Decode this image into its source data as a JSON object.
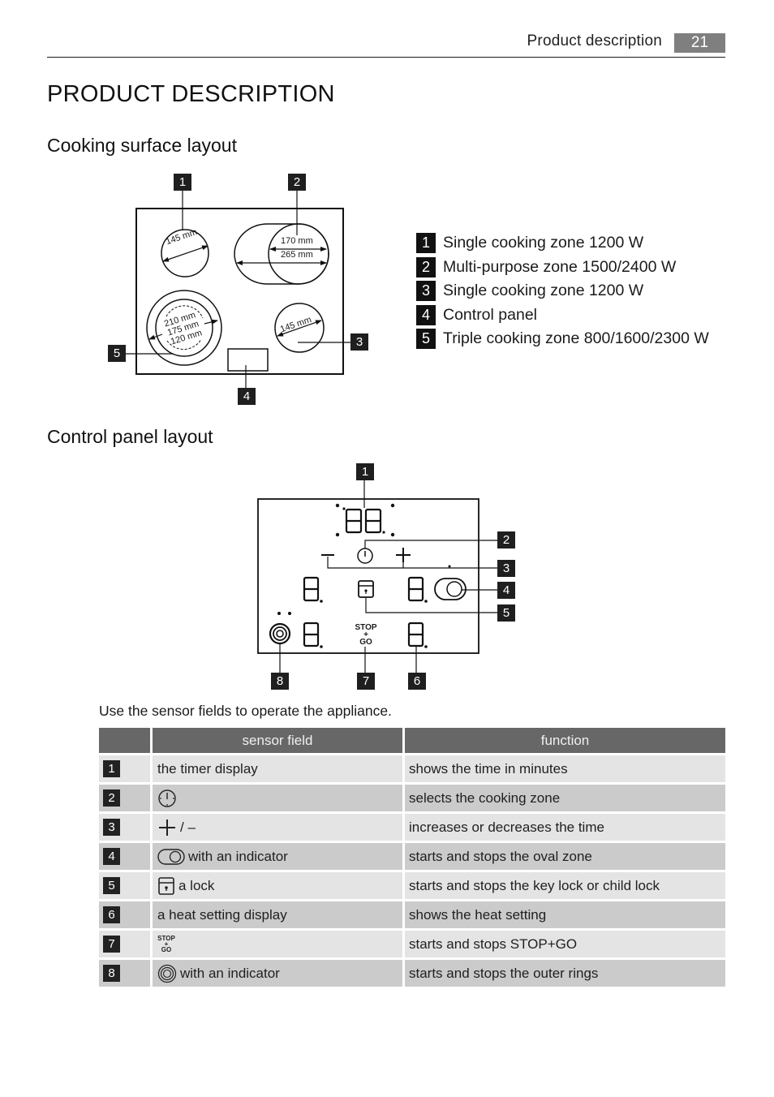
{
  "header": {
    "running_title": "Product description",
    "page_number": "21"
  },
  "page_title": "PRODUCT DESCRIPTION",
  "cooking_surface": {
    "heading": "Cooking surface layout",
    "callouts": [
      "1",
      "2",
      "3",
      "4",
      "5"
    ],
    "dimensions": {
      "zone1": "145 mm",
      "zone2_inner": "170 mm",
      "zone2_outer": "265 mm",
      "zone3": "145 mm",
      "zone5_outer": "210 mm",
      "zone5_middle": "175 mm",
      "zone5_inner": "120 mm"
    },
    "legend": [
      {
        "num": "1",
        "text": "Single cooking zone 1200 W"
      },
      {
        "num": "2",
        "text": "Multi-purpose zone 1500/2400 W"
      },
      {
        "num": "3",
        "text": "Single cooking zone 1200 W"
      },
      {
        "num": "4",
        "text": "Control panel"
      },
      {
        "num": "5",
        "text": "Triple cooking zone 800/1600/2300 W"
      }
    ]
  },
  "control_panel": {
    "heading": "Control panel layout",
    "callouts": [
      "1",
      "2",
      "3",
      "4",
      "5",
      "6",
      "7",
      "8"
    ],
    "stop_label": "STOP",
    "plus_label": "+",
    "go_label": "GO"
  },
  "intro_text": "Use the sensor fields to operate the appliance.",
  "table": {
    "headers": [
      "",
      "sensor field",
      "function"
    ],
    "rows": [
      {
        "num": "1",
        "icon": "none",
        "sensor": "the timer display",
        "function": "shows the time in minutes"
      },
      {
        "num": "2",
        "icon": "timer-select-icon",
        "sensor": "",
        "function": "selects the cooking zone"
      },
      {
        "num": "3",
        "icon": "plus-icon",
        "sensor": "/ –",
        "function": "increases or decreases the time"
      },
      {
        "num": "4",
        "icon": "oval-zone-icon",
        "sensor": "with an indicator",
        "function": "starts and stops the oval zone"
      },
      {
        "num": "5",
        "icon": "lock-icon",
        "sensor": "a lock",
        "function": "starts and stops the key lock or child lock"
      },
      {
        "num": "6",
        "icon": "none",
        "sensor": "a heat setting display",
        "function": "shows the heat setting"
      },
      {
        "num": "7",
        "icon": "stop-go-icon",
        "sensor": "",
        "function": "starts and stops STOP+GO"
      },
      {
        "num": "8",
        "icon": "rings-icon",
        "sensor": "with an indicator",
        "function": "starts and stops the outer rings"
      }
    ]
  }
}
